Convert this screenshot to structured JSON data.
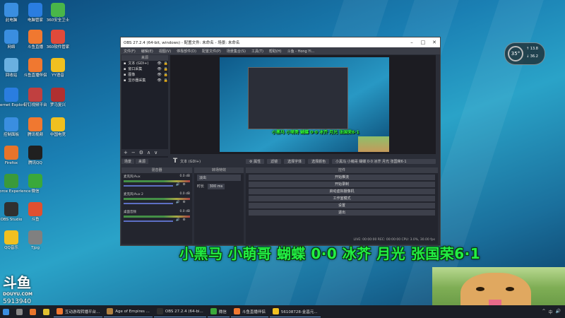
{
  "desktop": {
    "icons": [
      {
        "label": "此电脑",
        "icon": "computer-icon",
        "color": "#3a8ee0"
      },
      {
        "label": "电脑管家",
        "icon": "shield-icon",
        "color": "#2a7de0"
      },
      {
        "label": "360安全卫士",
        "icon": "360-icon",
        "color": "#49b649"
      },
      {
        "label": "网络",
        "icon": "network-icon",
        "color": "#3a8ee0"
      },
      {
        "label": "斗鱼直播",
        "icon": "douyu-icon",
        "color": "#f07830"
      },
      {
        "label": "360软件管家",
        "icon": "software-manager-icon",
        "color": "#e04a3a"
      },
      {
        "label": "回收站",
        "icon": "recycle-bin-icon",
        "color": "#6ab0e0"
      },
      {
        "label": "斗鱼直播伴侣",
        "icon": "douyu-companion-icon",
        "color": "#f07830"
      },
      {
        "label": "YY语音",
        "icon": "yy-icon",
        "color": "#f0c020"
      },
      {
        "label": "Internet Explorer",
        "icon": "ie-icon",
        "color": "#2a7de0"
      },
      {
        "label": "钉钉视频平台",
        "icon": "dingtalk-icon",
        "color": "#c04040"
      },
      {
        "label": "罗马复兴",
        "icon": "game-icon",
        "color": "#b03030"
      },
      {
        "label": "控制面板",
        "icon": "control-panel-icon",
        "color": "#3a8ee0"
      },
      {
        "label": "腾讯视频",
        "icon": "tencent-video-icon",
        "color": "#f07830"
      },
      {
        "label": "中国电竞",
        "icon": "esports-icon",
        "color": "#f0c020"
      },
      {
        "label": "Firefox",
        "icon": "firefox-icon",
        "color": "#e8742a"
      },
      {
        "label": "腾讯QQ",
        "icon": "qq-icon",
        "color": "#202020"
      },
      {
        "label": "GeForce Experience",
        "icon": "geforce-icon",
        "color": "#3a9a3a"
      },
      {
        "label": "微信",
        "icon": "wechat-icon",
        "color": "#3aa83a"
      },
      {
        "label": "OBS Studio",
        "icon": "obs-icon",
        "color": "#303030"
      },
      {
        "label": "斗鱼",
        "icon": "douyu-red-icon",
        "color": "#e05030"
      },
      {
        "label": "QQ音乐",
        "icon": "qq-music-icon",
        "color": "#f0c020"
      },
      {
        "label": "Tjpg",
        "icon": "image-icon",
        "color": "#808080"
      }
    ],
    "weather": {
      "temp": "35°",
      "up": "13.8",
      "down": "36.2"
    }
  },
  "obs": {
    "title": "OBS 27.2.4 (64-bit, windows) - 配置文件: 未命名 - 场景: 未命名",
    "menu": [
      "文件(F)",
      "编辑(E)",
      "视图(V)",
      "停靠部件(D)",
      "配置文件(P)",
      "场景集合(S)",
      "工具(T)",
      "帮助(H)",
      "斗鱼 - Hong Yi..."
    ],
    "sources_header": "来源",
    "sources": [
      {
        "name": "文本 (GDI+)"
      },
      {
        "name": "窗口采集"
      },
      {
        "name": "图像"
      },
      {
        "name": "显示器采集"
      }
    ],
    "source_tools": [
      "+",
      "−",
      "⚙",
      "∧",
      "∨"
    ],
    "scene_tabs": [
      "场景",
      "来源"
    ],
    "prop_bar": {
      "icon": "T",
      "label": "文本 (GDI+)",
      "props": "⚙ 属性",
      "filters": "滤镜",
      "select_font": "选择字体",
      "select_color": "选择颜色",
      "text": "小黑马 小萌哥 蝴蝶 0·0 冰芥 月光 张国荣6·1"
    },
    "mixer": {
      "header": "混音器",
      "channels": [
        {
          "name": "麦克风/Aux",
          "db": "0.0 dB"
        },
        {
          "name": "麦克风/Aux 2",
          "db": "0.0 dB"
        },
        {
          "name": "桌面音频",
          "db": "0.0 dB"
        }
      ]
    },
    "transitions": {
      "header": "转场特效",
      "type": "淡出",
      "duration_label": "时长",
      "duration": "300 ms"
    },
    "controls": {
      "header": "控件",
      "buttons": [
        "开始推流",
        "开始录制",
        "启动虚拟摄像机",
        "工作室模式",
        "设置",
        "退出"
      ],
      "status": "LIVE: 00:00:00   REC: 00:00:00   CPU: 3.0%, 30.00 fps"
    },
    "inner_overlay": "小黑马 小萌哥 蝴蝶 0·0 冰芥 月光 张国荣6·1"
  },
  "overlay_text": "小黑马 小萌哥 蝴蝶 0·0 冰芥 月光 张国荣6·1",
  "watermark": {
    "logo": "斗鱼",
    "sub": "DOUYU.COM",
    "room_id": "5913940"
  },
  "taskbar": {
    "items": [
      {
        "label": "",
        "icon": "start-icon",
        "color": "#3a8ee0"
      },
      {
        "label": "",
        "icon": "search-icon",
        "color": "#888888"
      },
      {
        "label": "",
        "icon": "firefox-icon",
        "color": "#e8742a"
      },
      {
        "label": "",
        "icon": "chrome-icon",
        "color": "#e0c030"
      },
      {
        "label": "互动游戏转播平台...",
        "icon": "douyu-icon",
        "color": "#f07830"
      },
      {
        "label": "Age of Empires ...",
        "icon": "game-icon",
        "color": "#b08040"
      },
      {
        "label": "OBS 27.2.4 (64-bi...",
        "icon": "obs-icon",
        "color": "#303030"
      },
      {
        "label": "微信",
        "icon": "wechat-icon",
        "color": "#3aa83a"
      },
      {
        "label": "斗鱼直播伴侣",
        "icon": "douyu-companion-icon",
        "color": "#f07830"
      },
      {
        "label": "56108728-金昌元...",
        "icon": "yy-icon",
        "color": "#f0c020"
      }
    ],
    "tray": [
      "^",
      "中",
      "🔊"
    ]
  }
}
